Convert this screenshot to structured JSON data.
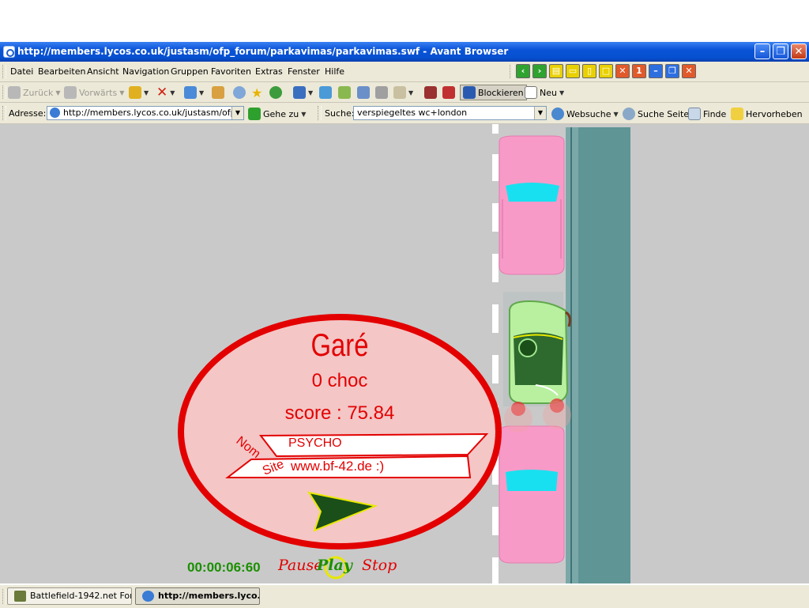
{
  "window": {
    "title": "http://members.lycos.co.uk/justasm/ofp_forum/parkavimas/parkavimas.swf - Avant Browser"
  },
  "menu": [
    "Datei",
    "Bearbeiten",
    "Ansicht",
    "Navigation",
    "Gruppen",
    "Favoriten",
    "Extras",
    "Fenster",
    "Hilfe"
  ],
  "toolbar": {
    "back_label": "Zurück",
    "forward_label": "Vorwärts",
    "block_label": "Blockieren",
    "new_label": "Neu",
    "counter_badge": "1"
  },
  "addressbar": {
    "address_label": "Adresse:",
    "address_value": "http://members.lycos.co.uk/justasm/ofp_f",
    "go_label": "Gehe zu",
    "search_label": "Suche:",
    "search_value": "verspiegeltes wc+london",
    "websearch_label": "Websuche",
    "searchpage_label": "Suche Seite",
    "find_label": "Finde",
    "highlight_label": "Hervorheben"
  },
  "game": {
    "result_title": "Garé",
    "shocks": "0 choc",
    "score": "score : 75.84",
    "name_label": "Nom",
    "name_value": "PSYCHO",
    "site_label": "Site",
    "site_value": "www.bf-42.de :)",
    "timer": "00:00:06:60",
    "pause_label": "Pause",
    "play_label": "Play",
    "stop_label": "Stop",
    "colors": {
      "road": "#c9c9c9",
      "sidewalk": "#5f9595",
      "parked_car": "#f89ac8",
      "player_car": "#b8f0a0",
      "dialog_border": "#e30000",
      "dialog_fill": "#f4c6c6",
      "timer_text": "#1a8f00"
    }
  },
  "taskbar": {
    "tasks": [
      "Battlefield-1942.net For...",
      "http://members.lyco..."
    ]
  }
}
